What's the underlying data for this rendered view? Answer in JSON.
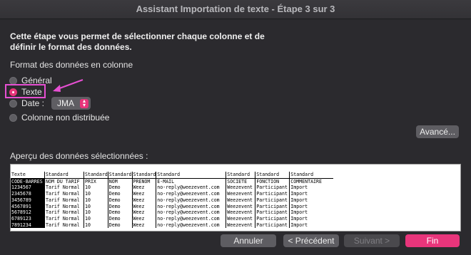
{
  "window": {
    "title": "Assistant Importation de texte - Étape 3 sur 3"
  },
  "description": "Cette étape vous permet de sélectionner chaque colonne et de définir le format des données.",
  "format_section": {
    "label": "Format des données en colonne",
    "options": {
      "general": "Général",
      "texte": "Texte",
      "date": "Date :",
      "skip": "Colonne non distribuée"
    },
    "selected": "texte",
    "date_format": "JMA"
  },
  "advanced_button": "Avancé...",
  "preview": {
    "label": "Aperçu des données sélectionnées :",
    "formats": [
      "Texte",
      "Standard",
      "Standard",
      "Standard",
      "Standard",
      "Standard",
      "Standard",
      "Standard",
      "Standard"
    ],
    "rows": [
      [
        "CODE-BARRES",
        "NOM DU TARIF",
        "PRIX",
        "NOM",
        "PRENOM",
        "E-MAIL",
        "SOCIETE",
        "FONCTION",
        "COMMENTAIRE"
      ],
      [
        "1234567",
        "Tarif Normal",
        "10",
        "Demo",
        "Weez",
        "no-reply@weezevent.com",
        "Weezevent",
        "Participant",
        "Import"
      ],
      [
        "2345678",
        "Tarif Normal",
        "10",
        "Demo",
        "Weez",
        "no-reply@weezevent.com",
        "Weezevent",
        "Participant",
        "Import"
      ],
      [
        "3456789",
        "Tarif Normal",
        "10",
        "Demo",
        "Weez",
        "no-reply@weezevent.com",
        "Weezevent",
        "Participant",
        "Import"
      ],
      [
        "4567891",
        "Tarif Normal",
        "10",
        "Demo",
        "Weez",
        "no-reply@weezevent.com",
        "Weezevent",
        "Participant",
        "Import"
      ],
      [
        "5678912",
        "Tarif Normal",
        "10",
        "Demo",
        "Weez",
        "no-reply@weezevent.com",
        "Weezevent",
        "Participant",
        "Import"
      ],
      [
        "6789123",
        "Tarif Normal",
        "10",
        "Demo",
        "Weez",
        "no-reply@weezevent.com",
        "Weezevent",
        "Participant",
        "Import"
      ],
      [
        "7891234",
        "Tarif Normal",
        "10",
        "Demo",
        "Weez",
        "no-reply@weezevent.com",
        "Weezevent",
        "Participant",
        "Import"
      ]
    ]
  },
  "buttons": {
    "cancel": "Annuler",
    "previous": "< Précédent",
    "next": "Suivant >",
    "finish": "Fin"
  },
  "colors": {
    "accent": "#e8357b",
    "highlight": "#e64fd2"
  }
}
